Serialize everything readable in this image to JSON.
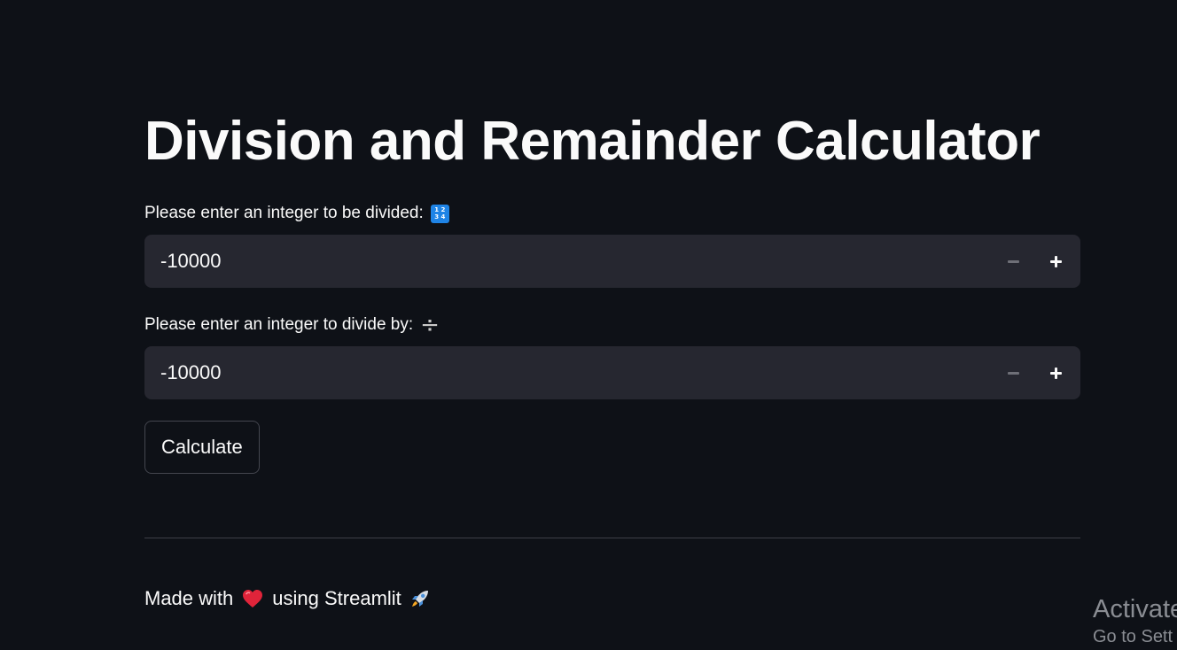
{
  "title": "Division and Remainder Calculator",
  "dividend": {
    "label": "Please enter an integer to be divided:",
    "emoji": "1 2\n3 4",
    "value": "-10000"
  },
  "divisor": {
    "label": "Please enter an integer to divide by:",
    "emoji": "÷",
    "value": "-10000"
  },
  "calculate_label": "Calculate",
  "footer": {
    "text_before": "Made with",
    "text_after": "using Streamlit"
  },
  "watermark": {
    "line1": "Activate",
    "line2": "Go to Sett"
  },
  "colors": {
    "background": "#0e1117",
    "input_bg": "#262730",
    "text": "#fafafa"
  }
}
